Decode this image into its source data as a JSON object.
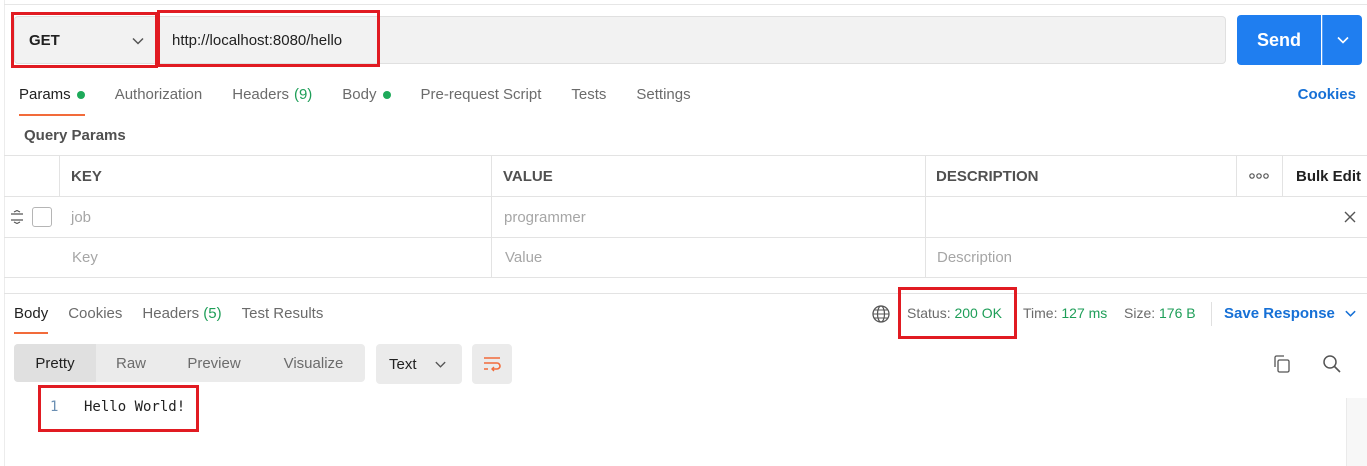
{
  "request": {
    "method": "GET",
    "url": "http://localhost:8080/hello",
    "send_label": "Send"
  },
  "tabs": [
    {
      "label": "Params",
      "dot": true
    },
    {
      "label": "Authorization"
    },
    {
      "label": "Headers",
      "count": "(9)"
    },
    {
      "label": "Body",
      "dot": true
    },
    {
      "label": "Pre-request Script"
    },
    {
      "label": "Tests"
    },
    {
      "label": "Settings"
    }
  ],
  "cookies_label": "Cookies",
  "query_params_title": "Query Params",
  "params_table": {
    "headers": {
      "key": "KEY",
      "value": "VALUE",
      "description": "DESCRIPTION",
      "bulk_edit": "Bulk Edit"
    },
    "rows": [
      {
        "key": "job",
        "value": "programmer",
        "description": ""
      }
    ],
    "placeholders": {
      "key": "Key",
      "value": "Value",
      "description": "Description"
    }
  },
  "response": {
    "tabs": [
      {
        "label": "Body"
      },
      {
        "label": "Cookies"
      },
      {
        "label": "Headers",
        "count": "(5)"
      },
      {
        "label": "Test Results"
      }
    ],
    "status_label": "Status:",
    "status_value": "200 OK",
    "time_label": "Time:",
    "time_value": "127 ms",
    "size_label": "Size:",
    "size_value": "176 B",
    "save_label": "Save Response",
    "formats": [
      "Pretty",
      "Raw",
      "Preview",
      "Visualize"
    ],
    "format_type": "Text",
    "body_lines": [
      {
        "num": "1",
        "text": "Hello World!"
      }
    ]
  },
  "colors": {
    "accent_orange": "#f26b3a",
    "send_blue": "#1f7ef0",
    "status_green": "#1e9e58",
    "highlight_red": "#e11b22"
  }
}
